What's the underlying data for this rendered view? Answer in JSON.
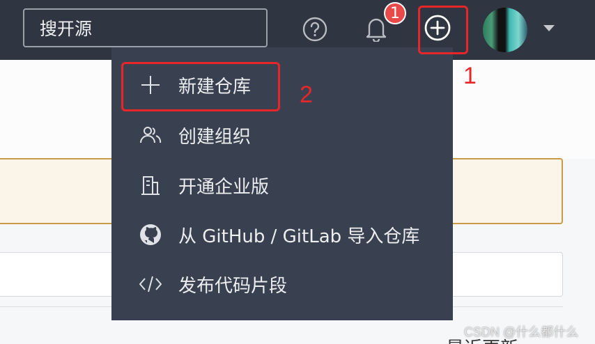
{
  "header": {
    "search_text": "搜开源",
    "notification_count": "1",
    "icons": [
      "help-icon",
      "bell-icon",
      "plus-circle-icon",
      "caret-down-icon"
    ]
  },
  "menu": {
    "items": [
      {
        "label": "新建仓库",
        "icon": "plus-icon"
      },
      {
        "label": "创建组织",
        "icon": "users-icon"
      },
      {
        "label": "开通企业版",
        "icon": "building-icon"
      },
      {
        "label": "从 GitHub / GitLab 导入仓库",
        "icon": "github-icon"
      },
      {
        "label": "发布代码片段",
        "icon": "code-icon"
      }
    ]
  },
  "annotations": {
    "label_1": "1",
    "label_2": "2",
    "color": "#e8262a"
  },
  "page": {
    "recent_label": "最近更新"
  },
  "watermark": "CSDN @什么都什么",
  "colors": {
    "topbar": "#2f3541",
    "dropdown": "#394150",
    "badge": "#e84a4a"
  }
}
